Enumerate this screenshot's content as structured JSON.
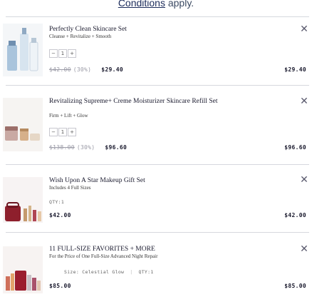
{
  "notice": {
    "link_text": "Conditions",
    "suffix": " apply."
  },
  "items": [
    {
      "title": "Perfectly Clean Skincare Set",
      "subtitle": "Cleanse + Revitalize + Smooth",
      "image": "skincare-bottles-image",
      "quantity": "1",
      "original_price": "$42.00",
      "discount": "(30%)",
      "price": "$29.40",
      "total": "$29.40"
    },
    {
      "title": "Revitalizing Supreme+ Creme Moisturizer Skincare Refill Set",
      "subtitle": "Firm + Lift + Glow",
      "image": "moisturizer-jars-image",
      "quantity": "1",
      "original_price": "$138.00",
      "discount": "(30%)",
      "price": "$96.60",
      "total": "$96.60"
    },
    {
      "title": "Wish Upon A Star Makeup Gift Set",
      "subtitle": "Includes 4 Full Sizes",
      "image": "makeup-bag-image",
      "qty_label": "QTY:1",
      "price": "$42.00",
      "total": "$42.00"
    },
    {
      "title": "11 FULL-SIZE FAVORITES + MORE",
      "subtitle": "For the Price of One Full-Size Advanced Night Repair",
      "image": "gift-collection-image",
      "size_label": "Size: Celestial Glow",
      "qty_label": "QTY:1",
      "price": "$85.00",
      "total": "$85.00"
    }
  ],
  "icons": {
    "close": "close-icon",
    "minus": "minus-icon",
    "plus": "plus-icon"
  },
  "colors": {
    "text": "#1a1a2e",
    "muted": "#9a9aa6",
    "divider": "#d6d8de"
  }
}
